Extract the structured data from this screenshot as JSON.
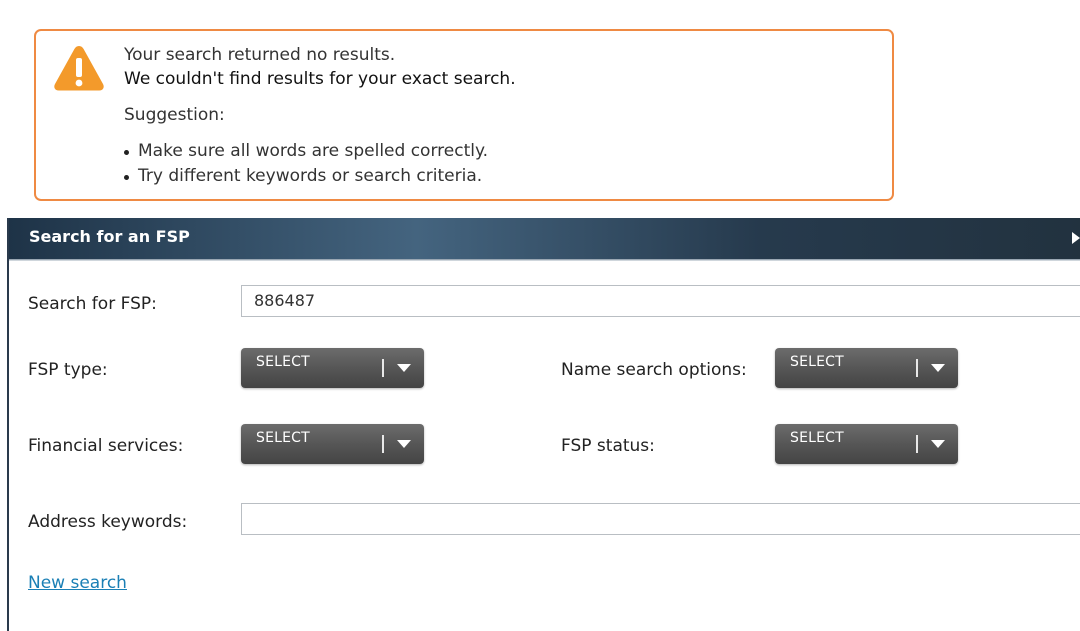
{
  "alert": {
    "icon": "warning-icon",
    "border_color": "#ef8a43",
    "icon_color": "#f39a2b",
    "line1": "Your search returned no results.",
    "line2": "We couldn't find results for your exact search.",
    "suggestion_label": "Suggestion:",
    "suggestions": [
      "Make sure all words are spelled correctly.",
      "Try different keywords or search criteria."
    ]
  },
  "panel": {
    "title": "Search for an FSP",
    "collapse_icon": "triangle-right-icon"
  },
  "form": {
    "fsp_search": {
      "label": "Search for FSP:",
      "value": "886487"
    },
    "fsp_type": {
      "label": "FSP type:",
      "selected": "SELECT"
    },
    "name_search_options": {
      "label": "Name search options:",
      "selected": "SELECT"
    },
    "financial_services": {
      "label": "Financial services:",
      "selected": "SELECT"
    },
    "fsp_status": {
      "label": "FSP status:",
      "selected": "SELECT"
    },
    "address_keywords": {
      "label": "Address keywords:",
      "value": ""
    },
    "new_search_link": "New search"
  }
}
